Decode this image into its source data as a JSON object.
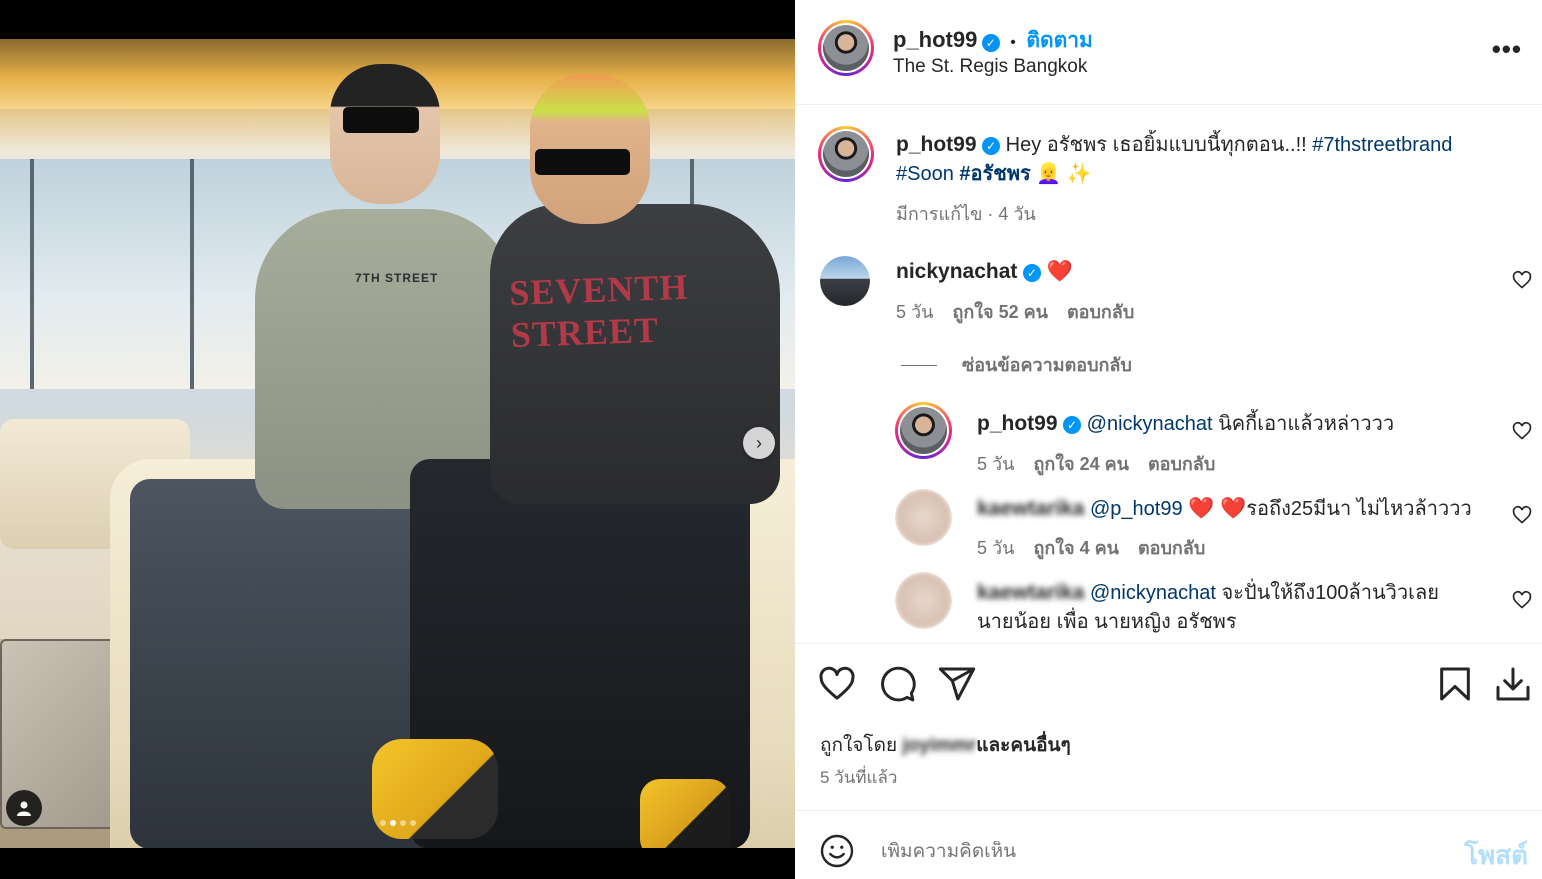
{
  "post": {
    "author": "p_hot99",
    "separator": "•",
    "follow_label": "ติดตาม",
    "location": "The St. Regis Bangkok",
    "more_label": "•••"
  },
  "media": {
    "shirt_print_1": "7TH STREET",
    "shirt_print_2": "SEVENTH STREET",
    "carousel_next": "›",
    "dots": 4,
    "active_dot": 1
  },
  "caption": {
    "user": "p_hot99",
    "text": "Hey อรัชพร เธอยิ้มแบบนี้ทุกตอน..!! ",
    "hashtag1": "#7thstreetbrand",
    "hashtag2": "#Soon",
    "hashtag3": "#อรัชพร",
    "emoji": "👱‍♀️ ✨",
    "meta": "มีการแก้ไข · 4 วัน"
  },
  "comments": [
    {
      "user": "nickynachat",
      "text": "❤️",
      "age": "5 วัน",
      "likes": "ถูกใจ 52 คน",
      "reply_label": "ตอบกลับ"
    }
  ],
  "hide_replies_label": "ซ่อนข้อความตอบกลับ",
  "replies": [
    {
      "user": "p_hot99",
      "mention": "@nickynachat",
      "text": " นิคกี้เอาแล้วหล่าววว",
      "age": "5 วัน",
      "likes": "ถูกใจ 24 คน",
      "reply_label": "ตอบกลับ"
    },
    {
      "user": "kaewtarika",
      "mention": "@p_hot99",
      "text": "รอถึง25มีนา ไม่ไหวล้าววว",
      "hearts": "❤️ ❤️",
      "age": "5 วัน",
      "likes": "ถูกใจ 4 คน",
      "reply_label": "ตอบกลับ"
    },
    {
      "user": "kaewtarika",
      "mention": "@nickynachat",
      "text": " จะปั่นให้ถึง100ล้านวิวเลย",
      "text2": "นายน้อย เพื่อ นายหญิง อรัชพร"
    }
  ],
  "engagement": {
    "liked_by_prefix": "ถูกใจโดย ",
    "liked_by_user": "joyimmr",
    "liked_by_suffix": "และคนอื่นๆ",
    "time_ago": "5 วันที่แล้ว"
  },
  "composer": {
    "placeholder": "เพิ่มความคิดเห็น",
    "post_label": "โพสต์"
  },
  "colors": {
    "link": "#00376b",
    "accent": "#0095f6",
    "muted": "#737373",
    "post_disabled": "#b2dffc"
  }
}
